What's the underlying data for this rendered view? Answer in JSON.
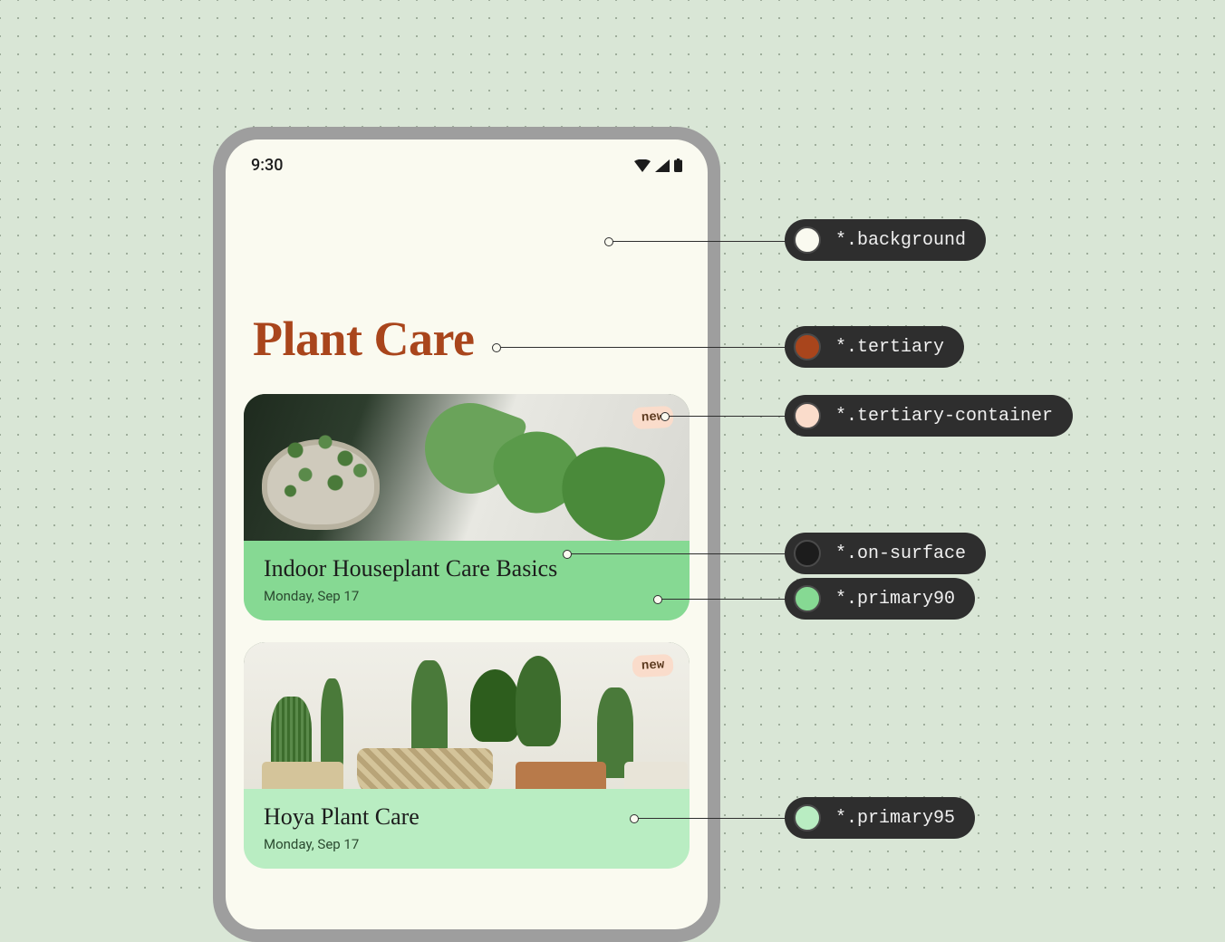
{
  "status": {
    "time": "9:30"
  },
  "page": {
    "title": "Plant Care"
  },
  "cards": [
    {
      "badge": "new",
      "title": "Indoor Houseplant Care Basics",
      "date": "Monday, Sep 17",
      "footer_variant": "p90"
    },
    {
      "badge": "new",
      "title": "Hoya Plant Care",
      "date": "Monday, Sep 17",
      "footer_variant": "p95"
    }
  ],
  "annotations": [
    {
      "label": "*.background",
      "swatch": "#fafaf0"
    },
    {
      "label": "*.tertiary",
      "swatch": "#a9451c"
    },
    {
      "label": "*.tertiary-container",
      "swatch": "#fadccb"
    },
    {
      "label": "*.on-surface",
      "swatch": "#1c1c1c"
    },
    {
      "label": "*.primary90",
      "swatch": "#86d993"
    },
    {
      "label": "*.primary95",
      "swatch": "#b9edc2"
    }
  ]
}
